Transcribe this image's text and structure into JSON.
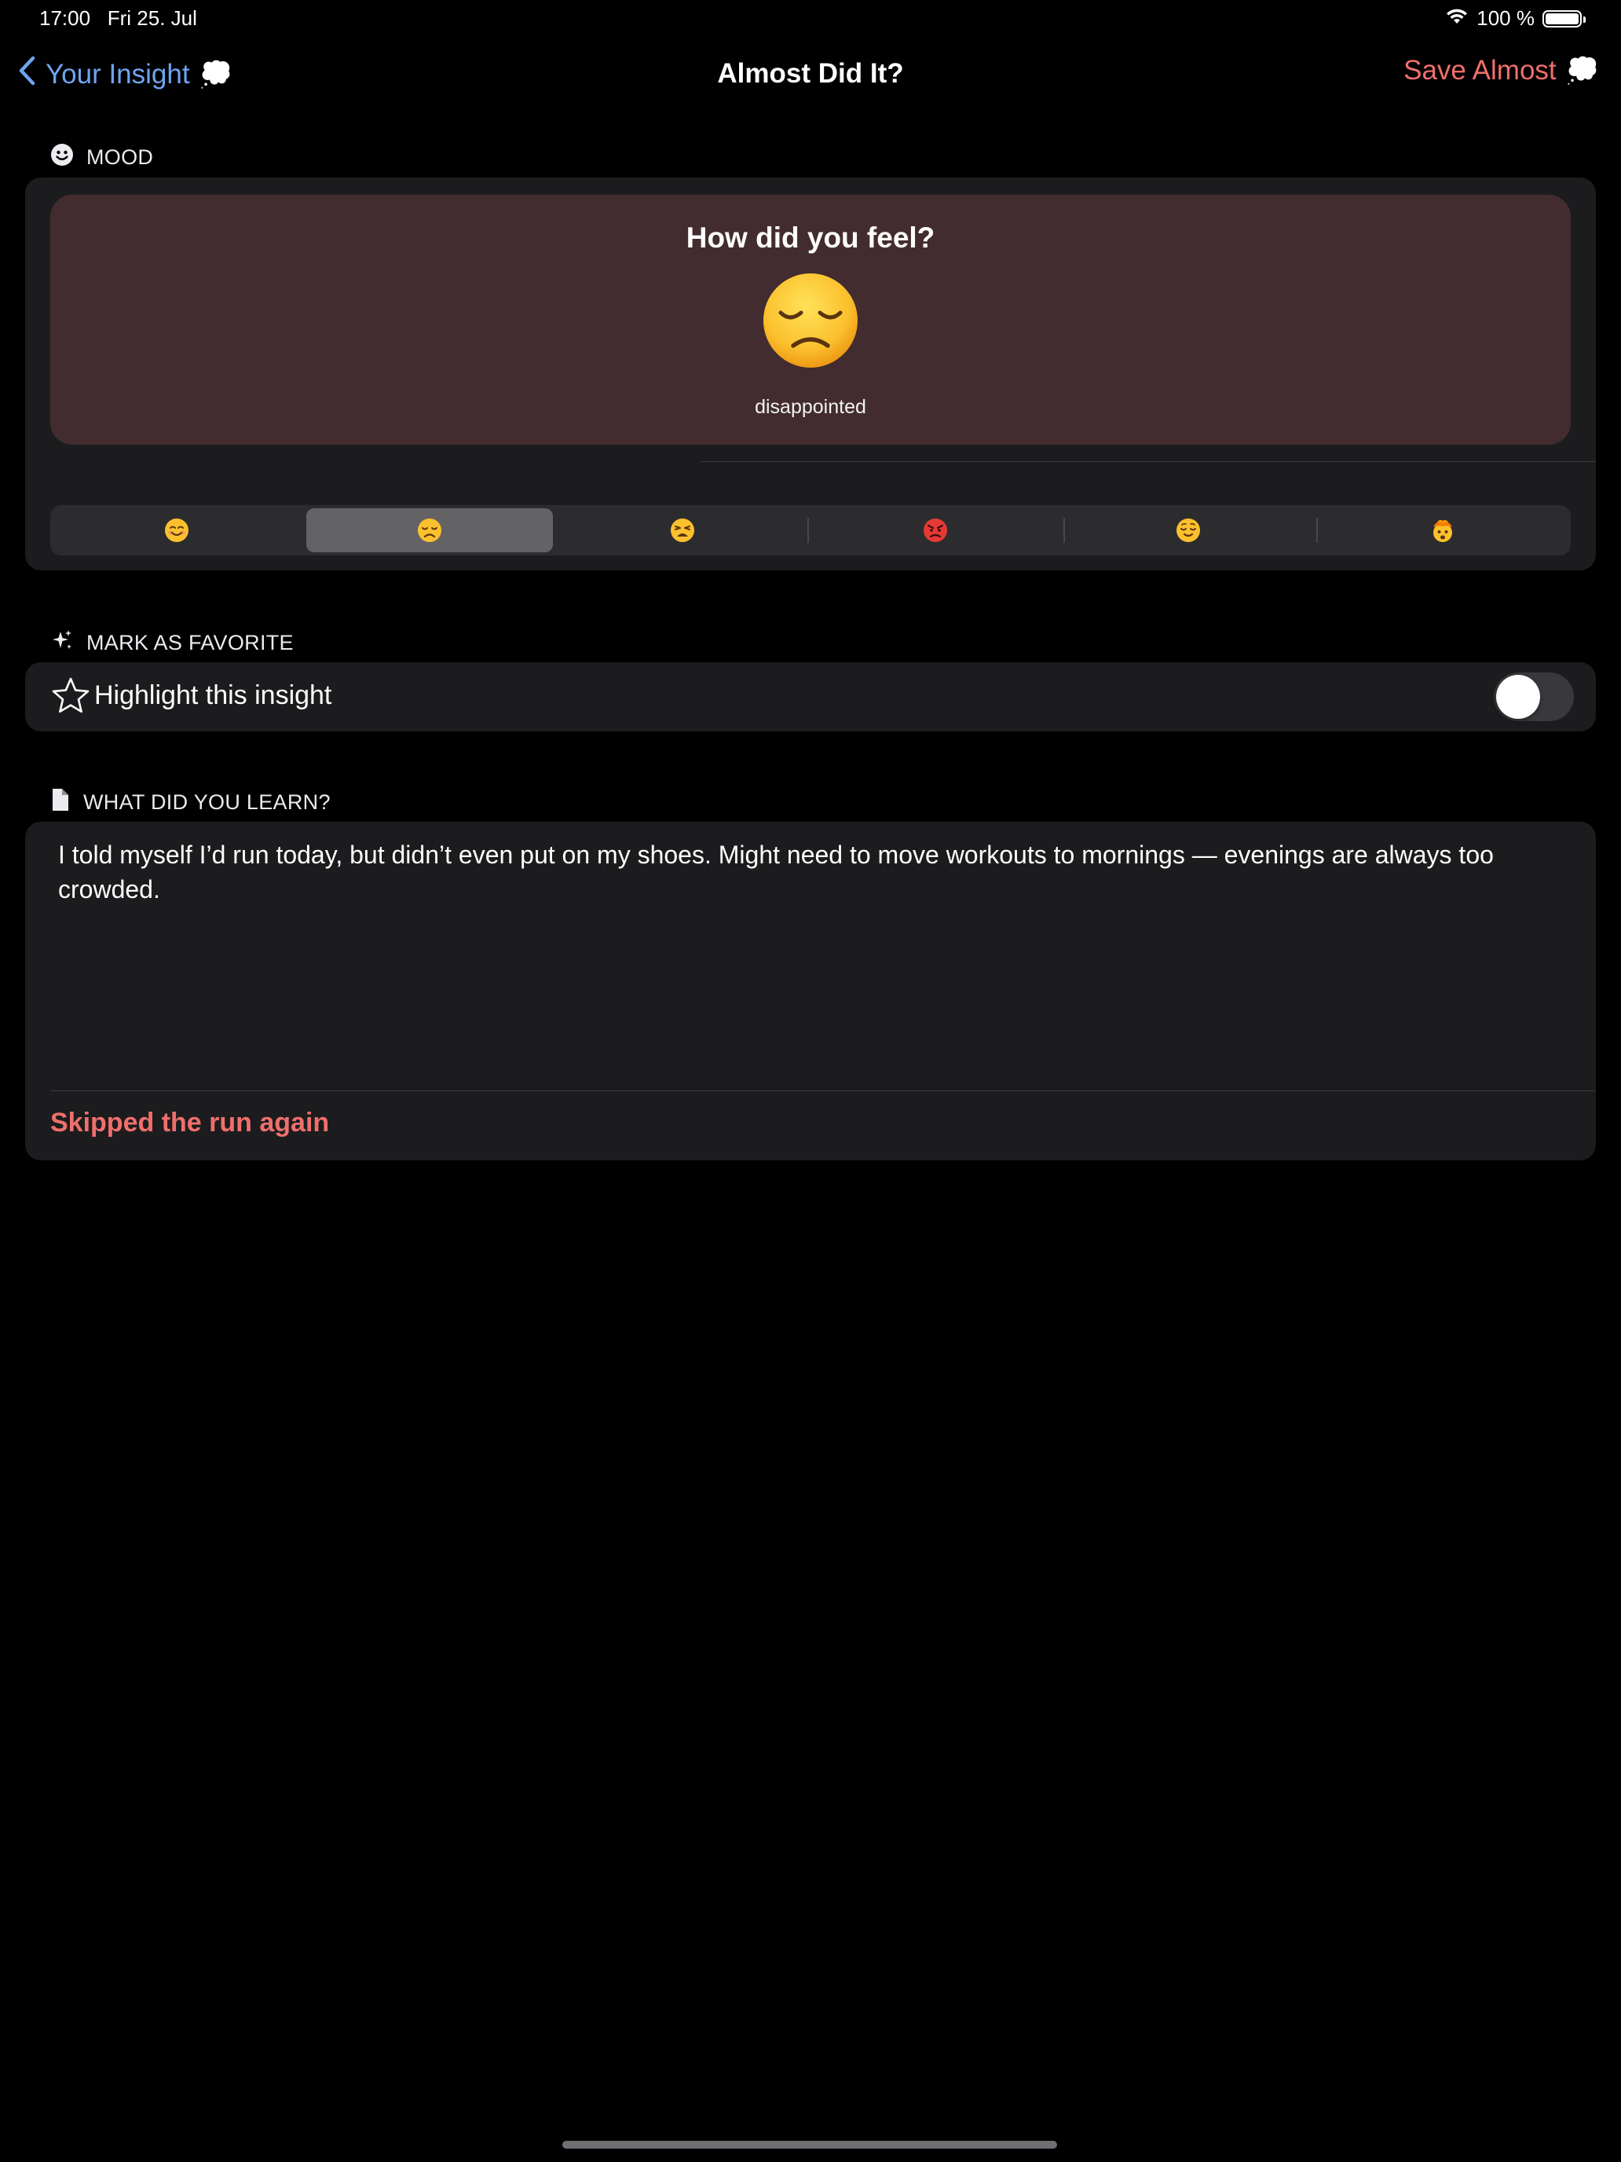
{
  "status_bar": {
    "time_date": "17:00   Fri 25. Jul",
    "battery_text": "100 %",
    "wifi_icon": "wifi-icon",
    "battery_icon": "battery-icon"
  },
  "nav": {
    "back_label": "Your Insight",
    "back_emoji": "💭",
    "title": "Almost Did It?",
    "save_label": "Save Almost",
    "save_emoji": "💭"
  },
  "mood": {
    "header": "MOOD",
    "question": "How did you feel?",
    "selected_emoji": "😞",
    "selected_label": "disappointed",
    "options": [
      "😊",
      "😞",
      "😩",
      "😡",
      "😌",
      "🤯"
    ],
    "selected_index": 1
  },
  "favorite": {
    "header": "MARK AS FAVORITE",
    "label": "Highlight this insight",
    "toggle_on": false
  },
  "learn": {
    "header": "WHAT DID YOU LEARN?",
    "text": "I told myself I’d run today, but didn’t even put on my shoes. Might need to move workouts to mornings — evenings are always too crowded.",
    "link": "Skipped the run again"
  },
  "colors": {
    "background": "#000000",
    "card": "#1c1c1e",
    "mood_panel": "#432c2f",
    "accent_blue": "#6ea4f0",
    "accent_red": "#ef6f6c"
  }
}
